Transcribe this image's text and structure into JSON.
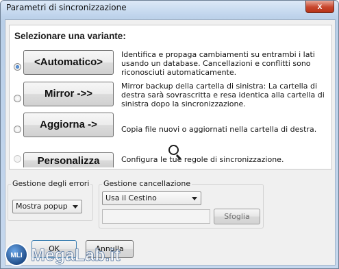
{
  "window": {
    "title": "Parametri di sincronizzazione",
    "close_label": "x"
  },
  "variants": {
    "heading": "Selezionare una variante:",
    "options": [
      {
        "label": "<Automatico>",
        "description": "Identifica e propaga cambiamenti su entrambi i lati usando un database. Cancellazioni e conflitti sono riconosciuti automaticamente.",
        "selected": true
      },
      {
        "label": "Mirror ->>",
        "description": "Mirror backup della cartella di sinistra: La cartella di destra sarà sovrascritta e resa identica alla cartella di sinistra dopo la sincronizzazione.",
        "selected": false
      },
      {
        "label": "Aggiorna ->",
        "description": "Copia file nuovi o aggiornati nella cartella di destra.",
        "selected": false
      },
      {
        "label": "Personalizza",
        "description": "Configura le tue regole di sincronizzazione.",
        "selected": false
      }
    ]
  },
  "error_handling": {
    "label": "Gestione degli errori",
    "selected": "Mostra popup"
  },
  "deletion_handling": {
    "label": "Gestione cancellazione",
    "selected": "Usa il Cestino",
    "path_value": "",
    "browse_label": "Sfoglia"
  },
  "footer": {
    "ok_label": "OK",
    "cancel_label": "Annulla"
  },
  "watermark": {
    "text": "MegaLab.it",
    "badge": "MLI"
  }
}
